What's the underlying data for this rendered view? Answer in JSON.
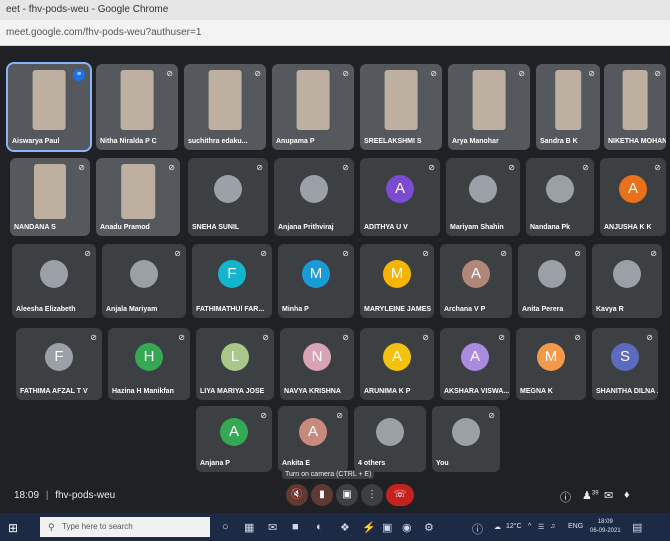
{
  "window_title": "eet - fhv-pods-weu - Google Chrome",
  "url": "meet.google.com/fhv-pods-weu?authuser=1",
  "participants": [
    {
      "name": "Aiswarya Paul",
      "type": "video",
      "speaking": true
    },
    {
      "name": "Nitha Niralda P C",
      "type": "video"
    },
    {
      "name": "suchithra edaku...",
      "type": "video"
    },
    {
      "name": "Anupama P",
      "type": "video"
    },
    {
      "name": "SREELAKSHMI S",
      "type": "video"
    },
    {
      "name": "Arya Manohar",
      "type": "video"
    },
    {
      "name": "Sandra B K",
      "type": "video"
    },
    {
      "name": "NIKETHA MOHAN",
      "type": "video"
    },
    {
      "name": "NANDANA S",
      "type": "video"
    },
    {
      "name": "Anadu Pramod",
      "type": "video"
    },
    {
      "name": "SNEHA SUNIL",
      "type": "photo"
    },
    {
      "name": "Anjana Prithviraj",
      "type": "photo"
    },
    {
      "name": "ADITHYA U V",
      "type": "letter",
      "letter": "A",
      "color": "#7b4bd1"
    },
    {
      "name": "Mariyam Shahin",
      "type": "photo"
    },
    {
      "name": "Nandana Pk",
      "type": "photo"
    },
    {
      "name": "ANJUSHA K K",
      "type": "letter",
      "letter": "A",
      "color": "#e8711a"
    },
    {
      "name": "Aleesha Elizabeth",
      "type": "photo"
    },
    {
      "name": "Anjala Mariyam",
      "type": "photo"
    },
    {
      "name": "FATHIMATHUl FAR...",
      "type": "letter",
      "letter": "F",
      "color": "#12b5cb"
    },
    {
      "name": "Minha P",
      "type": "letter",
      "letter": "M",
      "color": "#1a9bd7"
    },
    {
      "name": "MARYLEINE JAMES",
      "type": "letter",
      "letter": "M",
      "color": "#f6b400"
    },
    {
      "name": "Archana V P",
      "type": "letter",
      "letter": "A",
      "color": "#b0887a"
    },
    {
      "name": "Anita Perera",
      "type": "photo"
    },
    {
      "name": "Kavya R",
      "type": "photo"
    },
    {
      "name": "FATHIMA AFZAL T V",
      "type": "letter",
      "letter": "F",
      "color": "#9aa0a6"
    },
    {
      "name": "Hazina H Manikfan",
      "type": "letter",
      "letter": "H",
      "color": "#34a853"
    },
    {
      "name": "LIYA MARIYA JOSE",
      "type": "letter",
      "letter": "L",
      "color": "#a8c78b"
    },
    {
      "name": "NAVYA KRISHNA",
      "type": "letter",
      "letter": "N",
      "color": "#d7a3b5"
    },
    {
      "name": "ARUNIMA K P",
      "type": "letter",
      "letter": "A",
      "color": "#f4c20d"
    },
    {
      "name": "AKSHARA VISWA...",
      "type": "letter",
      "letter": "A",
      "color": "#a98be0"
    },
    {
      "name": "MEGNA K",
      "type": "letter",
      "letter": "M",
      "color": "#f2994a"
    },
    {
      "name": "SHANITHA DILNA ...",
      "type": "letter",
      "letter": "S",
      "color": "#5c6bc0"
    },
    {
      "name": "Anjana P",
      "type": "letter",
      "letter": "A",
      "color": "#34a853"
    },
    {
      "name": "Ankita E",
      "type": "letter",
      "letter": "A",
      "color": "#c98a7e"
    },
    {
      "name": "4 others",
      "type": "others"
    },
    {
      "name": "You",
      "type": "photo"
    }
  ],
  "tooltip": "Turn on camera (CTRL + E)",
  "footer": {
    "time": "18:09",
    "divider": "|",
    "meeting_code": "fhv-pods-weu",
    "people_badge": "39"
  },
  "taskbar": {
    "search_placeholder": "Type here to search",
    "temperature": "12°C",
    "language": "ENG",
    "clock_time": "18:09",
    "clock_date": "06-09-2021"
  }
}
